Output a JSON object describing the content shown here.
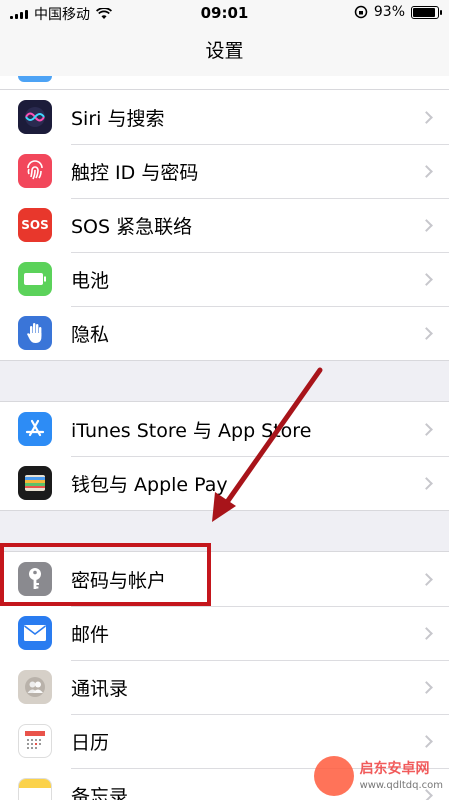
{
  "status": {
    "carrier": "中国移动",
    "time": "09:01",
    "battery": "93%",
    "battery_level": 0.93
  },
  "title": "设置",
  "groups": [
    {
      "rows": [
        {
          "label": "Siri 与搜索",
          "icon": "siri-icon",
          "color": "#1c1c3a"
        },
        {
          "label": "触控 ID 与密码",
          "icon": "fingerprint-icon",
          "color": "#f2475b"
        },
        {
          "label": "SOS 紧急联络",
          "icon": "sos-icon",
          "color": "#e8372c",
          "icon_text": "SOS"
        },
        {
          "label": "电池",
          "icon": "battery-icon",
          "color": "#5bd25a"
        },
        {
          "label": "隐私",
          "icon": "hand-icon",
          "color": "#3a75d8"
        }
      ]
    },
    {
      "rows": [
        {
          "label": "iTunes Store 与 App Store",
          "icon": "app-store-icon",
          "color": "#2d8cf5"
        },
        {
          "label": "钱包与 Apple Pay",
          "icon": "wallet-icon",
          "color": "#1b1b1b"
        }
      ]
    },
    {
      "rows": [
        {
          "label": "密码与帐户",
          "icon": "key-icon",
          "color": "#8a8a8f"
        },
        {
          "label": "邮件",
          "icon": "mail-icon",
          "color": "#2a7cf0"
        },
        {
          "label": "通讯录",
          "icon": "contacts-icon",
          "color": "#d6d0c8"
        },
        {
          "label": "日历",
          "icon": "calendar-icon",
          "color": "#ffffff"
        },
        {
          "label": "备忘录",
          "icon": "notes-icon",
          "color": "#fbd24a"
        }
      ]
    }
  ],
  "watermark": {
    "text": "启东安卓网",
    "url": "www.qdltdq.com"
  }
}
